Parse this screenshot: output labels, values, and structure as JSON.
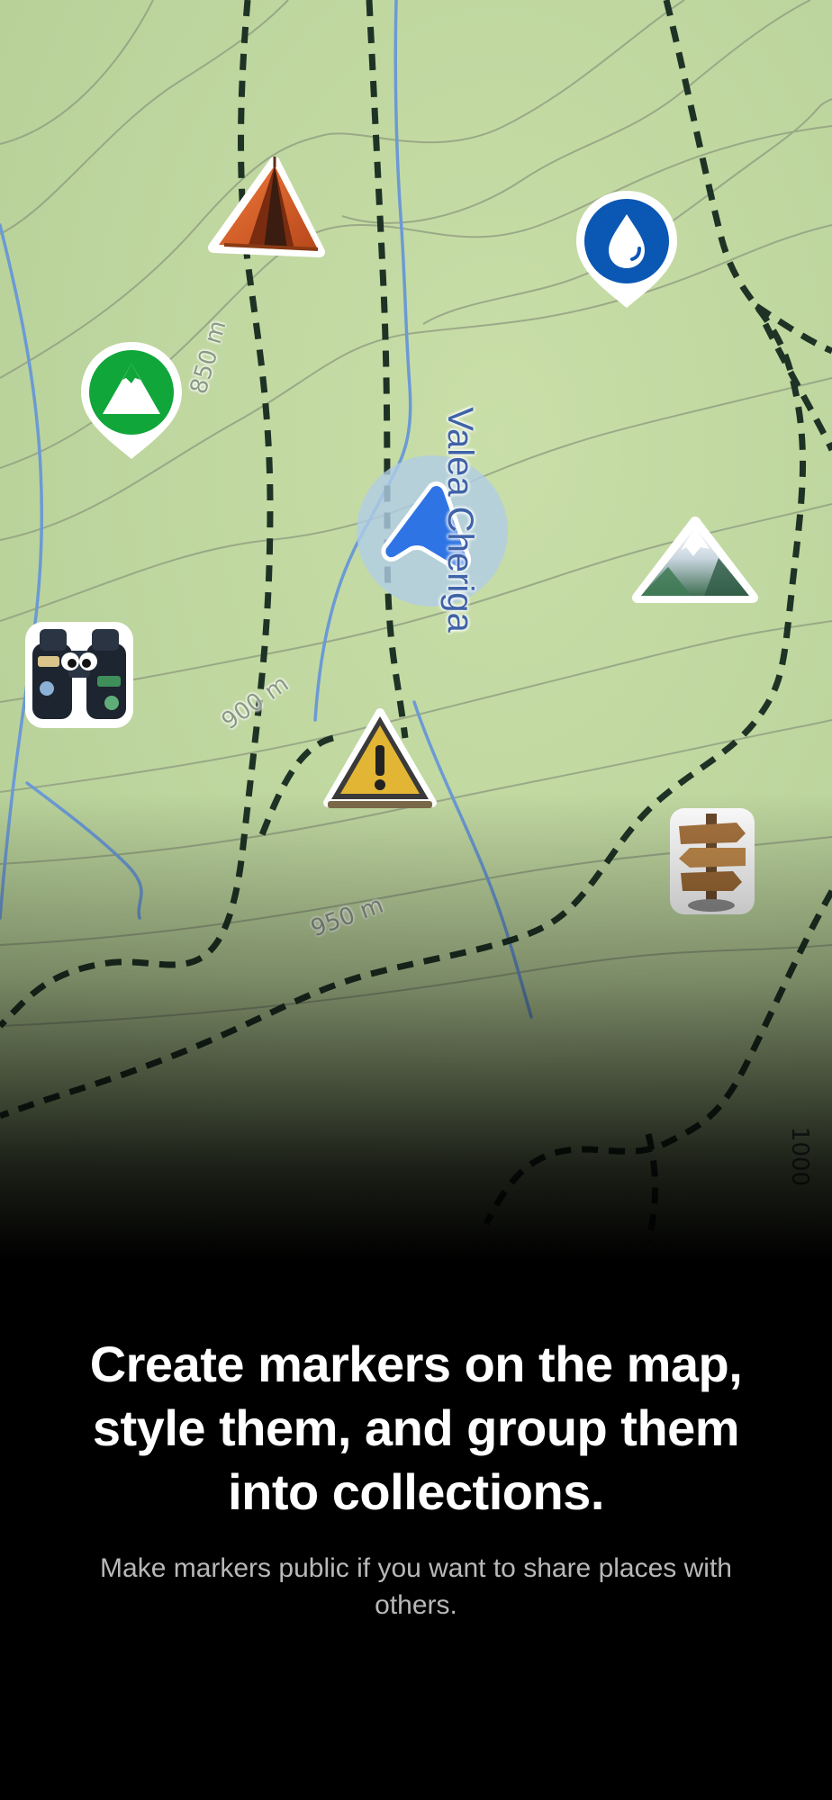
{
  "map": {
    "contour_labels": [
      "850 m",
      "900 m",
      "950 m",
      "1000"
    ],
    "road_label": "Valea Cheriga",
    "colors": {
      "terrain": "#c2d8a2",
      "contour": "#8d9a7e",
      "stream": "#6c9ad4",
      "trail": "#1e3325",
      "location": "#2f74e4"
    },
    "markers": [
      {
        "name": "tent-marker",
        "icon": "tent-icon"
      },
      {
        "name": "water-pin-marker",
        "icon": "water-drop-icon",
        "color": "#0b57b4"
      },
      {
        "name": "peak-pin-marker",
        "icon": "mountain-icon",
        "color": "#10a63a"
      },
      {
        "name": "binoculars-marker",
        "icon": "binoculars-icon"
      },
      {
        "name": "snowy-mountain-marker",
        "icon": "snowy-mountain-icon"
      },
      {
        "name": "warning-marker",
        "icon": "warning-sign-icon"
      },
      {
        "name": "signpost-marker",
        "icon": "signpost-icon"
      }
    ]
  },
  "onboarding": {
    "title": "Create markers on the map, style them, and group them into collections.",
    "subtitle": "Make markers public if you want to share places with others."
  }
}
